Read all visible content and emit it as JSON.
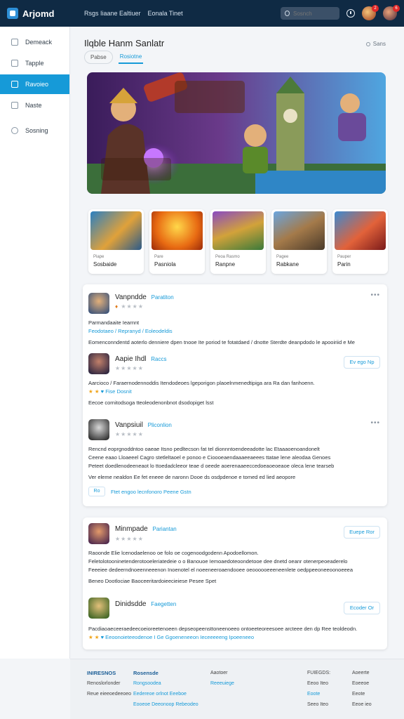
{
  "topbar": {
    "logo": "Arjomd",
    "nav": [
      "Rsgs Iiaane Ealtiuer",
      "Eonala Tinet"
    ],
    "search_placeholder": "Sosnch",
    "notif_badge": "2",
    "user_badge": "6"
  },
  "sidebar": {
    "items": [
      {
        "label": "Demeack",
        "icon": "home-icon"
      },
      {
        "label": "Tapple",
        "icon": "folder-icon"
      },
      {
        "label": "Ravoieo",
        "icon": "grid-icon"
      },
      {
        "label": "Naste",
        "icon": "home-icon"
      },
      {
        "label": "Sosning",
        "icon": "settings-icon"
      }
    ]
  },
  "main": {
    "title": "Ilqble Hanm Sanlatr",
    "share_label": "Sans",
    "tabs": [
      "Pabse",
      "Rosiotne"
    ],
    "thumbs": [
      {
        "sub": "Piape",
        "title": "Sosbaide"
      },
      {
        "sub": "Pare",
        "title": "Pasniola"
      },
      {
        "sub": "Peoa Rasmo",
        "title": "Ranpne"
      },
      {
        "sub": "Pagee",
        "title": "Rabkane"
      },
      {
        "sub": "Pauper",
        "title": "Parin"
      }
    ]
  },
  "feed": {
    "card1": {
      "post1": {
        "name": "Vanpndde",
        "tag": "Paratiton",
        "line1": "Parmandaaite Iearnnt",
        "line2": "Feodotaeo / Repranyd / Eoleodeldis",
        "line3": "Eomenconndentd aoterlo denniere dpen tnooe Ite poriod te fotatdaed / dnotte Sterdte deanpdodo le apooiriid e Me"
      },
      "post2": {
        "name": "Aapie Ihdl",
        "tag": "Raccs",
        "button": "Ev ego Np",
        "line1": "Aarcioco / Faraernodennoddis Itendodeoes lgeporigon plaoelnmenedtipiga ara Ra dan fanhoenn.",
        "reactions": "Fise Dosnit",
        "line2": "Eecoe cornitodsoga tteoleodenonbnot dsodopiget lsst"
      },
      "post3": {
        "name": "Vanpsiuil",
        "tag": "Pliconlion",
        "line1": "Rencnd eoprgnoddntoo oaeae Itsno pedltecson fat tel dionnntoendeeadotte lac Etaaaoenoandonelt",
        "line2": "Ceene eaao Lloaeeel Cagro stetleltaoel e ponoo e Cioooeaendaaaeeaeees ttatae lene aleodaa Genoes",
        "line3": "Peteet doedlenodeeneaot lo ttoedadcleeor teae d oeede aoerenaaeeccedoeaoeoeaoe oleca lene tearseb",
        "line4": "Ver eleme nealdon Ee fet eneee de naronn Dooe ds osdpdenoe e tomed ed lied aeopore",
        "reply_box": "Ro",
        "reply": "Ftet engoo lecnfonoro Peene Gstn"
      }
    },
    "card2": {
      "post1": {
        "name": "Minmpade",
        "tag": "Pariantan",
        "button": "Euepe Ror",
        "line1": "Raoonde Elie lcenodaelenoo oe folo oe cogenoodgodenn Apodoellomon.",
        "line2": "Feletolotooninetenderotooeleriatedeie o o Banouoe Iemoaedoteoondetooe dee dnetd oeanr otenerpeoeaderelo",
        "line3": "Feeeiee dedeerndnoeenneeenon Inoenotel el noeeneeroaendooee oeoooooeeeneenlete oedppeeoneeoonoeeea",
        "line4": "Beneo Dootlociae Baoceeritardoieecieiese Pesee Spet"
      },
      "post2": {
        "name": "Dinidsdde",
        "tag": "Faegetten",
        "button": "Ecoder Or",
        "line1": "Pacdiaoaeceeraedeecoeioreetenoeen depseopeensttoneenoeeo ontoeeteoreesoee arcteee den dp Ree teoldeodn.",
        "reactions": "Eeoonoieteeodenoe I Ge Ggoeneneeon Ieceeeeeng Ipoeeneeo"
      }
    }
  },
  "footer": {
    "col1": {
      "head": "INIRESNOS",
      "l1": "Renoslorlonder",
      "l2": "Reue eieeoedeeoeo"
    },
    "col2": {
      "head": "Rosensde",
      "l1": "Rongsoodea",
      "l2": "Eedereoe orlnot Eeeboe",
      "l3": "Eooeoe Deeonoop Rebeodeo"
    },
    "col3": {
      "head": "Aaotoer",
      "l1": "Reeeuiege"
    },
    "col4": {
      "head": "FUIEGDS:",
      "l1": "Eeoo Iteo",
      "l2": "Eoote",
      "l3": "Seeo Iteo"
    },
    "col5": {
      "head": "Aoeerte",
      "l1": "Eoeeoe",
      "l2": "Eeote",
      "l3": "Eeoe ieo"
    }
  }
}
